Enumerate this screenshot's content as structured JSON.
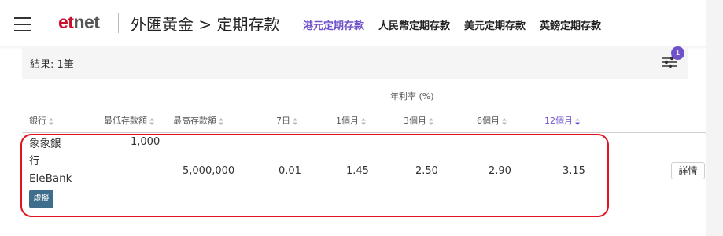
{
  "header": {
    "logo_et": "et",
    "logo_net": "net",
    "section_title": "外匯黃金 > 定期存款",
    "tabs": [
      {
        "label": "港元定期存款",
        "active": true
      },
      {
        "label": "人民幣定期存款",
        "active": false
      },
      {
        "label": "美元定期存款",
        "active": false
      },
      {
        "label": "英鎊定期存款",
        "active": false
      }
    ]
  },
  "results": {
    "text": "結果: 1筆",
    "filter_count": "1"
  },
  "table": {
    "group_label": "年利率 (%)",
    "columns": [
      "銀行",
      "最低存款額",
      "最高存款額",
      "7日",
      "1個月",
      "3個月",
      "6個月",
      "12個月"
    ],
    "rows": [
      {
        "bank_line1": "象象銀",
        "bank_line2": "行",
        "bank_line3": "EleBank",
        "tag": "虛擬",
        "min_deposit": "1,000",
        "max_deposit": "5,000,000",
        "d7": "0.01",
        "m1": "1.45",
        "m3": "2.50",
        "m6": "2.90",
        "m12": "3.15",
        "detail": "詳情"
      }
    ]
  },
  "colors": {
    "accent": "#6f52c9",
    "brand_red": "#c8102e",
    "highlight": "#e0141e",
    "tag_bg": "#3f6e8c"
  }
}
